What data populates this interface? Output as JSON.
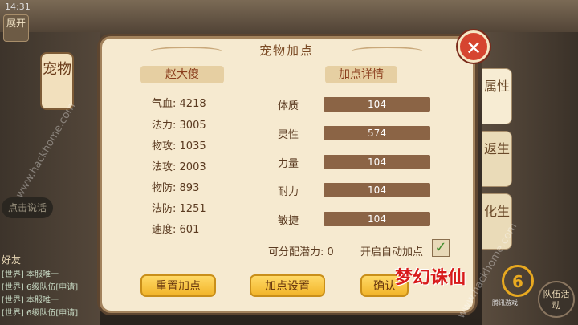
{
  "status": {
    "time": "14:31"
  },
  "background": {
    "top_left_button": "展开",
    "pet_tab_label": "宠物",
    "voice_button": "点击说话",
    "friends_button": "好友",
    "chat_lines": [
      "[世界] 本服唯一",
      "[世界] 6级队伍[申请]",
      "[世界] 本服唯一",
      "[世界] 6级队伍[申请]"
    ]
  },
  "right_tabs": [
    "属性",
    "返生",
    "化生"
  ],
  "corner_button": "队伍活动",
  "dialog": {
    "title": "宠物加点",
    "pet_name": "赵大傻",
    "detail_title": "加点详情",
    "stats": [
      {
        "label": "气血:",
        "value": "4218"
      },
      {
        "label": "法力:",
        "value": "3005"
      },
      {
        "label": "物攻:",
        "value": "1035"
      },
      {
        "label": "法攻:",
        "value": "2003"
      },
      {
        "label": "物防:",
        "value": "893"
      },
      {
        "label": "法防:",
        "value": "1251"
      },
      {
        "label": "速度:",
        "value": "601"
      }
    ],
    "attributes": [
      {
        "label": "体质",
        "value": "104"
      },
      {
        "label": "灵性",
        "value": "574"
      },
      {
        "label": "力量",
        "value": "104"
      },
      {
        "label": "耐力",
        "value": "104"
      },
      {
        "label": "敏捷",
        "value": "104"
      }
    ],
    "potential_label": "可分配潜力: 0",
    "auto_label": "开启自动加点",
    "auto_checked": true,
    "buttons": {
      "reset": "重置加点",
      "settings": "加点设置",
      "confirm": "确认"
    }
  },
  "branding": {
    "logo_text": "梦幻诛仙",
    "logo2_text": "腾讯游戏",
    "watermark": "www.hackhome.com"
  },
  "colors": {
    "panel": "#f6ead0",
    "accent": "#f2b52a",
    "bar": "#8b6445",
    "close": "#d64530"
  }
}
